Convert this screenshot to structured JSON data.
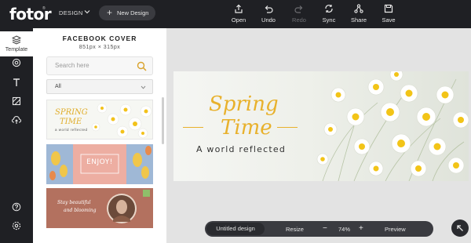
{
  "app": {
    "logo": "fotor",
    "logo_mark": "®"
  },
  "header": {
    "design_menu": "DESIGN",
    "new_design": "New Design",
    "tools": [
      {
        "label": "Open",
        "icon": "open-icon",
        "enabled": true
      },
      {
        "label": "Undo",
        "icon": "undo-icon",
        "enabled": true
      },
      {
        "label": "Redo",
        "icon": "redo-icon",
        "enabled": false
      },
      {
        "label": "Sync",
        "icon": "sync-icon",
        "enabled": true
      },
      {
        "label": "Share",
        "icon": "share-icon",
        "enabled": true
      },
      {
        "label": "Save",
        "icon": "save-icon",
        "enabled": true
      }
    ]
  },
  "rail": {
    "items": [
      {
        "label": "Template",
        "icon": "layers-icon",
        "active": true
      },
      {
        "icon": "sticker-icon"
      },
      {
        "icon": "text-icon"
      },
      {
        "icon": "background-icon"
      },
      {
        "icon": "upload-icon"
      }
    ],
    "bottom_icons": [
      "help-icon",
      "settings-icon"
    ]
  },
  "panel": {
    "title": "FACEBOOK COVER",
    "dimensions": "851px × 315px",
    "search_placeholder": "Search here",
    "filter_value": "All",
    "templates": [
      {
        "line1": "SPRING",
        "line2": "TIME",
        "tagline": "a world reflected"
      },
      {
        "text": "ENJOY!"
      },
      {
        "line1": "Stay beautiful",
        "line2": "and blooming"
      }
    ]
  },
  "canvas": {
    "title_line1": "Spring",
    "title_line2": "Time",
    "tagline": "A world reflected",
    "accent": "#e8b12c"
  },
  "bottombar": {
    "doc_name": "Untitled design",
    "resize": "Resize",
    "zoom": "74%",
    "minus": "−",
    "plus": "+",
    "preview": "Preview"
  }
}
